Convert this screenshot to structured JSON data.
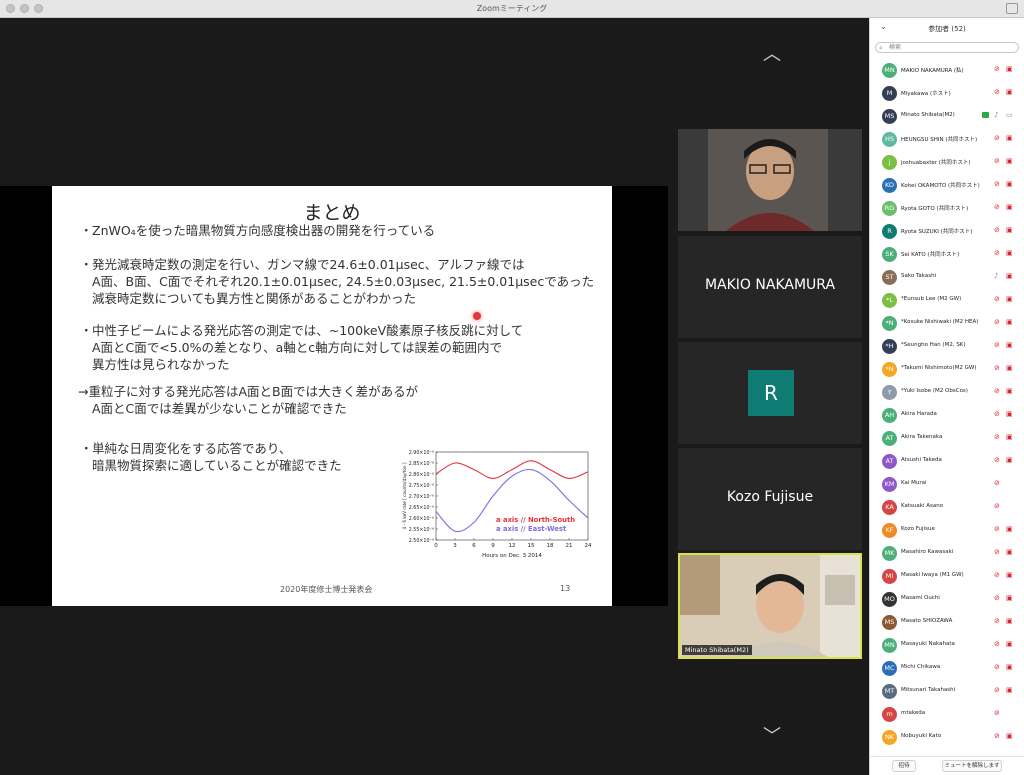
{
  "window": {
    "title": "Zoomミーティング"
  },
  "slide": {
    "title": "まとめ",
    "bullets": [
      [
        "ZnWO₄を使った暗黒物質方向感度検出器の開発を行っている"
      ],
      [
        "発光減衰時定数の測定を行い、ガンマ線で24.6±0.01μsec、アルファ線では",
        "A面、B面、C面でそれぞれ20.1±0.01μsec, 24.5±0.03μsec, 21.5±0.01μsecであった",
        "減衰時定数についても異方性と関係があることがわかった"
      ],
      [
        "中性子ビームによる発光応答の測定では、~100keV酸素原子核反跳に対して",
        "A面とC面で<5.0%の差となり、a軸とc軸方向に対しては誤差の範囲内で",
        "異方性は見られなかった"
      ],
      [
        "→重粒子に対する発光応答はA面とB面では大きく差があるが",
        "A面とC面では差異が少ないことが確認できた"
      ],
      [
        "単純な日周変化をする応答であり、",
        "暗黒物質探索に適していることが確認できた"
      ]
    ],
    "bullet_dot": "・",
    "footer": "2020年度修士博士発表会",
    "page": "13"
  },
  "chart_data": {
    "type": "line",
    "xlabel": "Hours on  Dec. 3 2014",
    "ylabel": "4 - 6 keV rate [ counts/day/ton ]",
    "x_ticks": [
      0,
      3,
      6,
      9,
      12,
      15,
      18,
      21,
      24
    ],
    "y_ticks": [
      "2.50×10⁻⁶",
      "2.55×10⁻⁶",
      "2.60×10⁻⁶",
      "2.65×10⁻⁶",
      "2.70×10⁻⁶",
      "2.75×10⁻⁶",
      "2.80×10⁻⁶",
      "2.85×10⁻⁶",
      "2.90×10⁻⁶"
    ],
    "xlim": [
      0,
      24
    ],
    "ylim": [
      2.5,
      2.9
    ],
    "series": [
      {
        "name": "a axis // North-South",
        "color": "#e8323c",
        "x": [
          0,
          3,
          6,
          9,
          12,
          15,
          18,
          21,
          24
        ],
        "y": [
          2.8,
          2.85,
          2.82,
          2.78,
          2.82,
          2.86,
          2.82,
          2.78,
          2.81
        ]
      },
      {
        "name": "a axis // East-West",
        "color": "#7a6ee0",
        "x": [
          0,
          3,
          6,
          9,
          12,
          15,
          18,
          21,
          24
        ],
        "y": [
          2.63,
          2.54,
          2.58,
          2.7,
          2.79,
          2.82,
          2.77,
          2.68,
          2.6
        ]
      }
    ]
  },
  "tiles": [
    {
      "label": ""
    },
    {
      "label": "MAKIO NAKAMURA"
    },
    {
      "label": "R"
    },
    {
      "label": "Kozo Fujisue"
    },
    {
      "label": "Minato Shibata(M2)"
    }
  ],
  "panel": {
    "title": "参加者 (52)",
    "search_placeholder": "検索",
    "footer_buttons": [
      "招待",
      "ミュートを解除します"
    ],
    "participants": [
      {
        "initials": "MN",
        "name": "MAKIO NAKAMURA (私)",
        "color": "#4caf7a",
        "mic": "off",
        "cam": "off"
      },
      {
        "initials": "M",
        "name": "Miyakawa (ホスト)",
        "color": "#333f55",
        "mic": "off",
        "cam": "off"
      },
      {
        "initials": "MS",
        "name": "Minato Shibata(M2)",
        "color": "#333f55",
        "mic": "on",
        "cam": "on",
        "share": true
      },
      {
        "initials": "HS",
        "name": "HEUNGSU SHIN (共同ホスト)",
        "color": "#5fb8a0",
        "mic": "off",
        "cam": "off"
      },
      {
        "initials": "j",
        "name": "joshuabaxter (共同ホスト)",
        "color": "#7bc043",
        "mic": "off",
        "cam": "off"
      },
      {
        "initials": "KO",
        "name": "Kohei OKAMOTO (共同ホスト)",
        "color": "#2a6fb8",
        "mic": "off",
        "cam": "off"
      },
      {
        "initials": "RG",
        "name": "Ryota GOTO (共同ホスト)",
        "color": "#6abf6a",
        "mic": "off",
        "cam": "off"
      },
      {
        "initials": "R",
        "name": "Ryota SUZUKI (共同ホスト)",
        "color": "#0e7c72",
        "mic": "off",
        "cam": "off"
      },
      {
        "initials": "SK",
        "name": "Sei KATO (共同ホスト)",
        "color": "#4caf7a",
        "mic": "off",
        "cam": "off"
      },
      {
        "initials": "ST",
        "name": "Sako Takashi",
        "color": "#8a6d55",
        "mic": "on",
        "cam": "off"
      },
      {
        "initials": "*L",
        "name": "*Eunsub Lee (M2 GW)",
        "color": "#7bc043",
        "mic": "off",
        "cam": "off"
      },
      {
        "initials": "*N",
        "name": "*Kosuke Nishiwaki (M2 HEA)",
        "color": "#4caf7a",
        "mic": "off",
        "cam": "off"
      },
      {
        "initials": "*H",
        "name": "*Seungho Han (M2, SK)",
        "color": "#333f55",
        "mic": "off",
        "cam": "off"
      },
      {
        "initials": "*N",
        "name": "*Takumi Nishimoto(M2 GW)",
        "color": "#f5a623",
        "mic": "off",
        "cam": "off"
      },
      {
        "initials": "Y",
        "name": "*Yuki Isobe (M2 ObsCos)",
        "color": "#8e9aa8",
        "mic": "off",
        "cam": "off"
      },
      {
        "initials": "AH",
        "name": "Akira Harada",
        "color": "#4caf7a",
        "mic": "off",
        "cam": "off"
      },
      {
        "initials": "AT",
        "name": "Akira Takenaka",
        "color": "#4caf7a",
        "mic": "off",
        "cam": "off"
      },
      {
        "initials": "AT",
        "name": "Atsushi Takeda",
        "color": "#8e58c8",
        "mic": "off",
        "cam": "off"
      },
      {
        "initials": "KM",
        "name": "Kai Murai",
        "color": "#8e58c8",
        "mic": "off",
        "cam": ""
      },
      {
        "initials": "KA",
        "name": "Katsuaki Asano",
        "color": "#d64545",
        "mic": "off",
        "cam": ""
      },
      {
        "initials": "KF",
        "name": "Kozo Fujisue",
        "color": "#f08a24",
        "mic": "off",
        "cam": "off"
      },
      {
        "initials": "MK",
        "name": "Masahiro Kawasaki",
        "color": "#4caf7a",
        "mic": "off",
        "cam": "off"
      },
      {
        "initials": "MI",
        "name": "Masaki Iwaya (M1 GW)",
        "color": "#d64545",
        "mic": "off",
        "cam": "off"
      },
      {
        "initials": "MO",
        "name": "Masami Ouchi",
        "color": "#333333",
        "mic": "off",
        "cam": "off"
      },
      {
        "initials": "MS",
        "name": "Masato SHIOZAWA",
        "color": "#8a5a30",
        "mic": "off",
        "cam": "off"
      },
      {
        "initials": "MN",
        "name": "Masayuki Nakahata",
        "color": "#4caf7a",
        "mic": "off",
        "cam": "off"
      },
      {
        "initials": "MC",
        "name": "Michi Chikawa",
        "color": "#2a6fb8",
        "mic": "off",
        "cam": "off"
      },
      {
        "initials": "MT",
        "name": "Mitsunari Takahashi",
        "color": "#5a6c80",
        "mic": "off",
        "cam": "off"
      },
      {
        "initials": "m",
        "name": "mtakeda",
        "color": "#d64545",
        "mic": "off",
        "cam": ""
      },
      {
        "initials": "NK",
        "name": "Nobuyuki Kato",
        "color": "#f5a623",
        "mic": "off",
        "cam": "off"
      }
    ]
  },
  "icons": {
    "mic_off": "mic-off-icon",
    "cam_off": "cam-off-icon",
    "search": "search-icon"
  }
}
